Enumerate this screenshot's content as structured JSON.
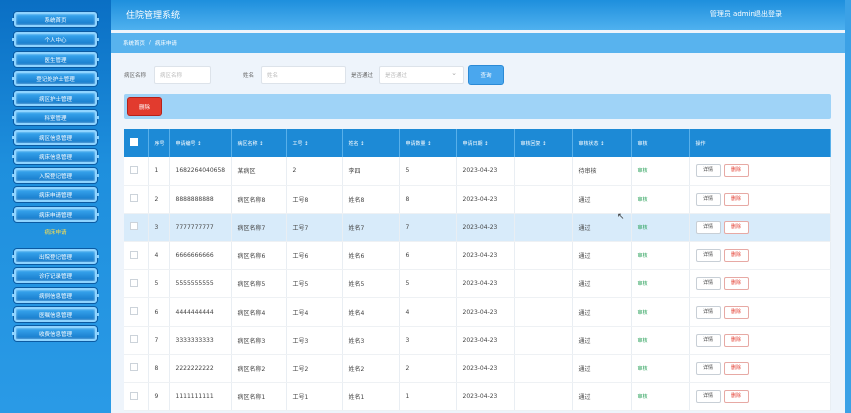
{
  "sidebar": {
    "items": [
      {
        "label": "系统首页"
      },
      {
        "label": "个人中心"
      },
      {
        "label": "医生管理"
      },
      {
        "label": "登记处护士管理"
      },
      {
        "label": "病区护士管理"
      },
      {
        "label": "科室管理"
      },
      {
        "label": "病区信息管理"
      },
      {
        "label": "病床信息管理"
      },
      {
        "label": "入院登记管理"
      },
      {
        "label": "病床申请管理"
      },
      {
        "label": "病床申请管理"
      },
      {
        "label": "病床申请"
      },
      {
        "label": "出院登记管理"
      },
      {
        "label": "诊疗记录管理"
      },
      {
        "label": "病例信息管理"
      },
      {
        "label": "医嘱信息管理"
      },
      {
        "label": "收费信息管理"
      }
    ]
  },
  "header": {
    "title": "住院管理系统",
    "user": "管理员 admin",
    "logout": "退出登录"
  },
  "breadcrumb": {
    "home": "系统首页",
    "separator": "/",
    "current": "病床申请"
  },
  "filter": {
    "ward_label": "病区名称",
    "ward_placeholder": "病区名称",
    "name_label": "姓名",
    "name_placeholder": "姓名",
    "approved_label": "是否通过",
    "approved_placeholder": "是否通过",
    "search_label": "查询"
  },
  "actions": {
    "delete_label": "删除"
  },
  "table": {
    "headers": [
      "序号",
      "申请编号 ↕",
      "病区名称 ↕",
      "工号 ↕",
      "姓名 ↕",
      "申请数量 ↕",
      "申请日期 ↕",
      "审核回复 ↕",
      "审核状态 ↕",
      "审核",
      "操作"
    ],
    "detail_label": "详情",
    "delete_label": "删除",
    "rows": [
      {
        "idx": "1",
        "code": "1682264040658",
        "ward": "某病区",
        "job": "2",
        "name": "李四",
        "qty": "5",
        "date": "2023-04-23",
        "reply": "",
        "status": "待审核",
        "audit": "审核"
      },
      {
        "idx": "2",
        "code": "8888888888",
        "ward": "病区名称8",
        "job": "工号8",
        "name": "姓名8",
        "qty": "8",
        "date": "2023-04-23",
        "reply": "",
        "status": "通过",
        "audit": "审核"
      },
      {
        "idx": "3",
        "code": "7777777777",
        "ward": "病区名称7",
        "job": "工号7",
        "name": "姓名7",
        "qty": "7",
        "date": "2023-04-23",
        "reply": "",
        "status": "通过",
        "audit": "审核"
      },
      {
        "idx": "4",
        "code": "6666666666",
        "ward": "病区名称6",
        "job": "工号6",
        "name": "姓名6",
        "qty": "6",
        "date": "2023-04-23",
        "reply": "",
        "status": "通过",
        "audit": "审核"
      },
      {
        "idx": "5",
        "code": "5555555555",
        "ward": "病区名称5",
        "job": "工号5",
        "name": "姓名5",
        "qty": "5",
        "date": "2023-04-23",
        "reply": "",
        "status": "通过",
        "audit": "审核"
      },
      {
        "idx": "6",
        "code": "4444444444",
        "ward": "病区名称4",
        "job": "工号4",
        "name": "姓名4",
        "qty": "4",
        "date": "2023-04-23",
        "reply": "",
        "status": "通过",
        "audit": "审核"
      },
      {
        "idx": "7",
        "code": "3333333333",
        "ward": "病区名称3",
        "job": "工号3",
        "name": "姓名3",
        "qty": "3",
        "date": "2023-04-23",
        "reply": "",
        "status": "通过",
        "audit": "审核"
      },
      {
        "idx": "8",
        "code": "2222222222",
        "ward": "病区名称2",
        "job": "工号2",
        "name": "姓名2",
        "qty": "2",
        "date": "2023-04-23",
        "reply": "",
        "status": "通过",
        "audit": "审核"
      },
      {
        "idx": "9",
        "code": "1111111111",
        "ward": "病区名称1",
        "job": "工号1",
        "name": "姓名1",
        "qty": "1",
        "date": "2023-04-23",
        "reply": "",
        "status": "通过",
        "audit": "审核"
      }
    ]
  },
  "colors": {
    "primary": "#1d8ad6",
    "danger": "#e23b2e",
    "highlight_row": "#d8ebfa"
  }
}
